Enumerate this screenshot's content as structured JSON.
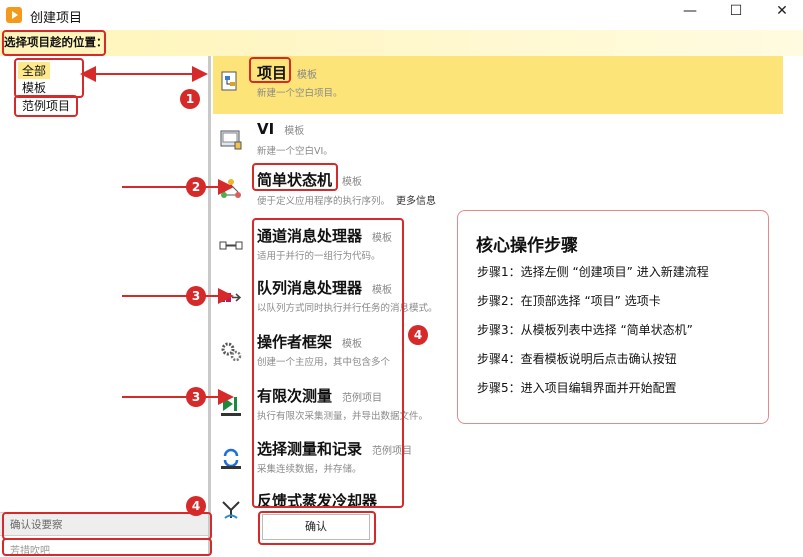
{
  "window": {
    "title": "创建项目",
    "controls": [
      "—",
      "☐",
      "✕"
    ]
  },
  "location_label": "选择项目趁的位置：",
  "left_pane": {
    "items": [
      {
        "label": "全部",
        "selected": true
      },
      {
        "label": "模板",
        "selected": false
      },
      {
        "label": "范例项目",
        "selected": false
      }
    ],
    "description_box": "确认设要察",
    "lower_text": "芳措吹吧"
  },
  "templates": [
    {
      "title": "项目",
      "tag": "模板",
      "desc": "新建一个空白项目。",
      "icon": "project-icon",
      "selected": true
    },
    {
      "title": "VI",
      "tag": "模板",
      "desc": "新建一个空白VI。",
      "icon": "vi-icon",
      "selected": false
    },
    {
      "title": "简单状态机",
      "tag": "模板",
      "desc": "便于定义应用程序的执行序列。",
      "extra": "更多信息",
      "icon": "state-machine-icon",
      "selected": false
    },
    {
      "title": "通道消息处理器",
      "tag": "模板",
      "desc": "适用于并行的一组行为代码。",
      "icon": "channel-handler-icon",
      "selected": false
    },
    {
      "title": "队列消息处理器",
      "tag": "模板",
      "desc": "以队列方式同时执行并行任务的消息模式。",
      "icon": "queue-handler-icon",
      "selected": false
    },
    {
      "title": "操作者框架",
      "tag": "模板",
      "desc": "创建一个主应用，其中包含多个",
      "icon": "gears-icon",
      "selected": false
    },
    {
      "title": "有限次测量",
      "tag": "范例项目",
      "desc": "执行有限次采集测量，并导出数据文件。",
      "icon": "finite-measurement-icon",
      "selected": false
    },
    {
      "title": "选择测量和记录",
      "tag": "范例项目",
      "desc": "采集连续数据，并存储。",
      "icon": "measure-log-icon",
      "selected": false
    },
    {
      "title": "反馈式蒸发冷却器",
      "tag": "",
      "desc": "",
      "icon": "evaporative-cooler-icon",
      "selected": false
    }
  ],
  "confirm_button": "确认",
  "steps_card": {
    "title": "核心操作步骤",
    "steps": [
      "步骤1：选择左侧 “创建项目” 进入新建流程",
      "步骤2：在顶部选择 “项目” 选项卡",
      "步骤3：从模板列表中选择 “简单状态机”",
      "步骤4：查看模板说明后点击确认按钮",
      "步骤5：进入项目编辑界面并开始配置"
    ]
  },
  "annotations": {
    "badges": [
      "1",
      "2",
      "3",
      "3",
      "4",
      "4"
    ],
    "color": "#d62a2a"
  }
}
